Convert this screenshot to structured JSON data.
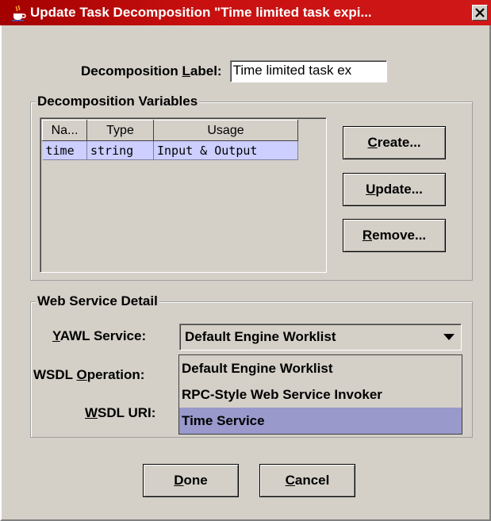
{
  "window": {
    "title": "Update Task Decomposition  \"Time limited task expi..."
  },
  "decomposition": {
    "label_prefix": "Decomposition ",
    "label_mnemonic": "L",
    "label_suffix": "abel:",
    "value": "Time limited task ex"
  },
  "variables": {
    "group_title": "Decomposition Variables",
    "columns": [
      "Na...",
      "Type",
      "Usage"
    ],
    "rows": [
      {
        "name": "time",
        "type": "string",
        "usage": "Input & Output"
      }
    ],
    "buttons": {
      "create_mn": "C",
      "create_rest": "reate...",
      "update_mn": "U",
      "update_rest": "pdate...",
      "remove_mn": "R",
      "remove_rest": "emove..."
    }
  },
  "web_service": {
    "group_title": "Web Service Detail",
    "yawl_label_mn": "Y",
    "yawl_label_rest": "AWL Service:",
    "yawl_selected": "Default Engine Worklist",
    "wsdl_op_prefix": "WSDL ",
    "wsdl_op_mn": "O",
    "wsdl_op_rest": "peration:",
    "wsdl_uri_mn": "W",
    "wsdl_uri_rest": "SDL URI:",
    "options": [
      "Default Engine Worklist",
      "RPC-Style Web Service Invoker",
      "Time Service"
    ],
    "highlighted_option": "Time Service"
  },
  "footer": {
    "done_mn": "D",
    "done_rest": "one",
    "cancel_mn": "C",
    "cancel_rest": "ancel"
  },
  "colors": {
    "title_bar": "#c81010",
    "selection": "#cccfff",
    "dropdown_highlight": "#9999cc"
  }
}
